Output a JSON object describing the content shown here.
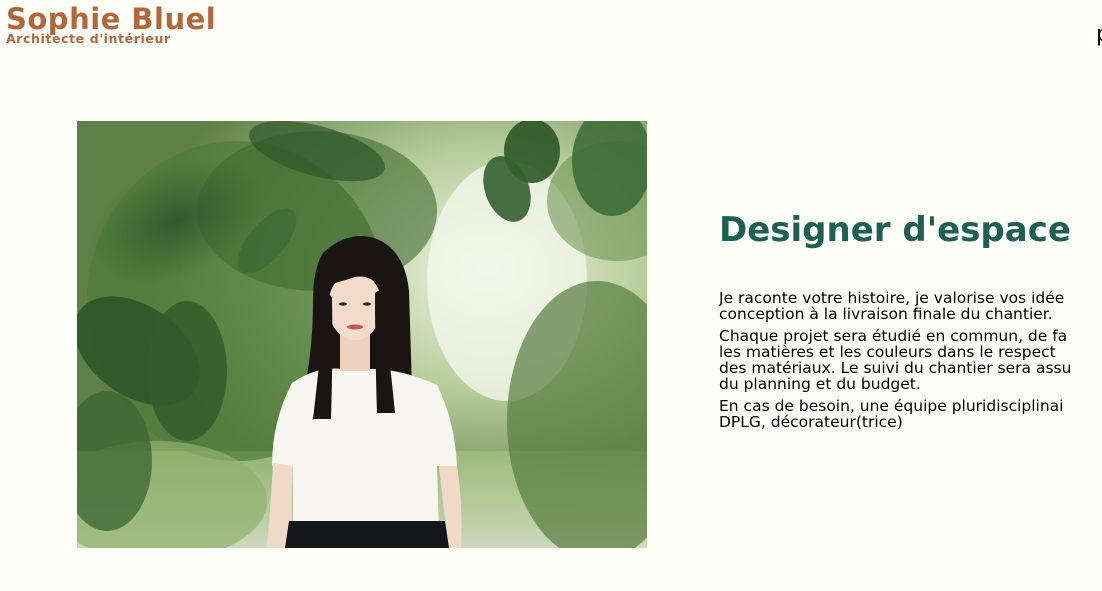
{
  "header": {
    "logo_title": "Sophie Bluel",
    "logo_subtitle": "Architecte d'intérieur",
    "nav_item_partial": "p"
  },
  "introduction": {
    "photo_alt": "",
    "title": "Designer d'espace",
    "paragraphs": [
      [
        "Je raconte votre histoire, je valorise vos idée",
        "conception à la livraison finale du chantier."
      ],
      [
        "Chaque projet sera étudié en commun, de fa",
        "les matières et les couleurs dans le respect",
        "des matériaux. Le suivi du chantier sera assu",
        "du planning et du budget."
      ],
      [
        "En cas de besoin, une équipe pluridisciplinai",
        "DPLG, décorateur(trice)"
      ]
    ]
  },
  "colors": {
    "background": "#fffef8",
    "brand_brown": "#b1663c",
    "title_green": "#1d6154"
  }
}
